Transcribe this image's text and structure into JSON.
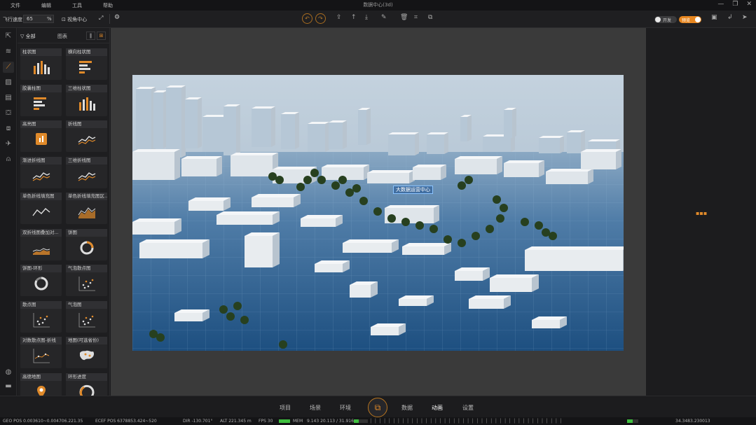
{
  "menu": {
    "items": [
      "文件",
      "编辑",
      "工具",
      "帮助"
    ]
  },
  "window": {
    "title": "数据中心(3d)",
    "controls": [
      "—",
      "❐",
      "✕"
    ]
  },
  "toolbar": {
    "speed_label": "飞行速度",
    "speed_value": "65",
    "speed_unit": "%",
    "view_center": "视角中心",
    "toggle_a_label": "开发",
    "toggle_b_label": "预览"
  },
  "panel": {
    "tab_all": "全部",
    "tab_chart": "图表",
    "cards": [
      {
        "title": "柱状图",
        "thumb": "bars"
      },
      {
        "title": "横向柱状图",
        "thumb": "hbars"
      },
      {
        "title": "胶囊柱图",
        "thumb": "hbars"
      },
      {
        "title": "三维柱状图",
        "thumb": "bars"
      },
      {
        "title": "高亮图",
        "thumb": "square"
      },
      {
        "title": "折线图",
        "thumb": "line"
      },
      {
        "title": "渐进折线图",
        "thumb": "line"
      },
      {
        "title": "三维折线图",
        "thumb": "line"
      },
      {
        "title": "单色折线填充图",
        "thumb": "line2"
      },
      {
        "title": "单色折线填充图区...",
        "thumb": "area"
      },
      {
        "title": "双折线图叠加对...",
        "thumb": "area2"
      },
      {
        "title": "饼图",
        "thumb": "ring-partial"
      },
      {
        "title": "饼图-环形",
        "thumb": "ring"
      },
      {
        "title": "气泡散点图",
        "thumb": "scatter"
      },
      {
        "title": "散点图",
        "thumb": "scatter"
      },
      {
        "title": "气泡图",
        "thumb": "scatter"
      },
      {
        "title": "对数散点图-折线",
        "thumb": "scatter-line"
      },
      {
        "title": "地图(可选省份)",
        "thumb": "map"
      },
      {
        "title": "高德地图",
        "thumb": "pin"
      },
      {
        "title": "环形进度",
        "thumb": "gauge"
      }
    ]
  },
  "scene": {
    "label": "大数据运营中心"
  },
  "bottom_nav": {
    "items": [
      "项目",
      "场景",
      "环境",
      "数据",
      "动画",
      "设置"
    ],
    "active": "动画"
  },
  "status": {
    "geo_pos": "GEO POS   0.003610~0.004706.221.35",
    "ecef_pos": "ECEF POS   6378853.424~520",
    "dir": "DIR  -130.701°",
    "alt": "ALT  221.345 m",
    "fps": "FPS  30",
    "mem_label": "MEM",
    "mem_value": "9.143  20.113 / 31.916",
    "mem_fill": 0.35,
    "right_value": "34.3483.230013",
    "gpu_fill": 0.5
  },
  "colors": {
    "accent": "#e08a2a",
    "sky": "#b7c6d5",
    "ground": "#245a8b",
    "building": "#e8ecef"
  }
}
